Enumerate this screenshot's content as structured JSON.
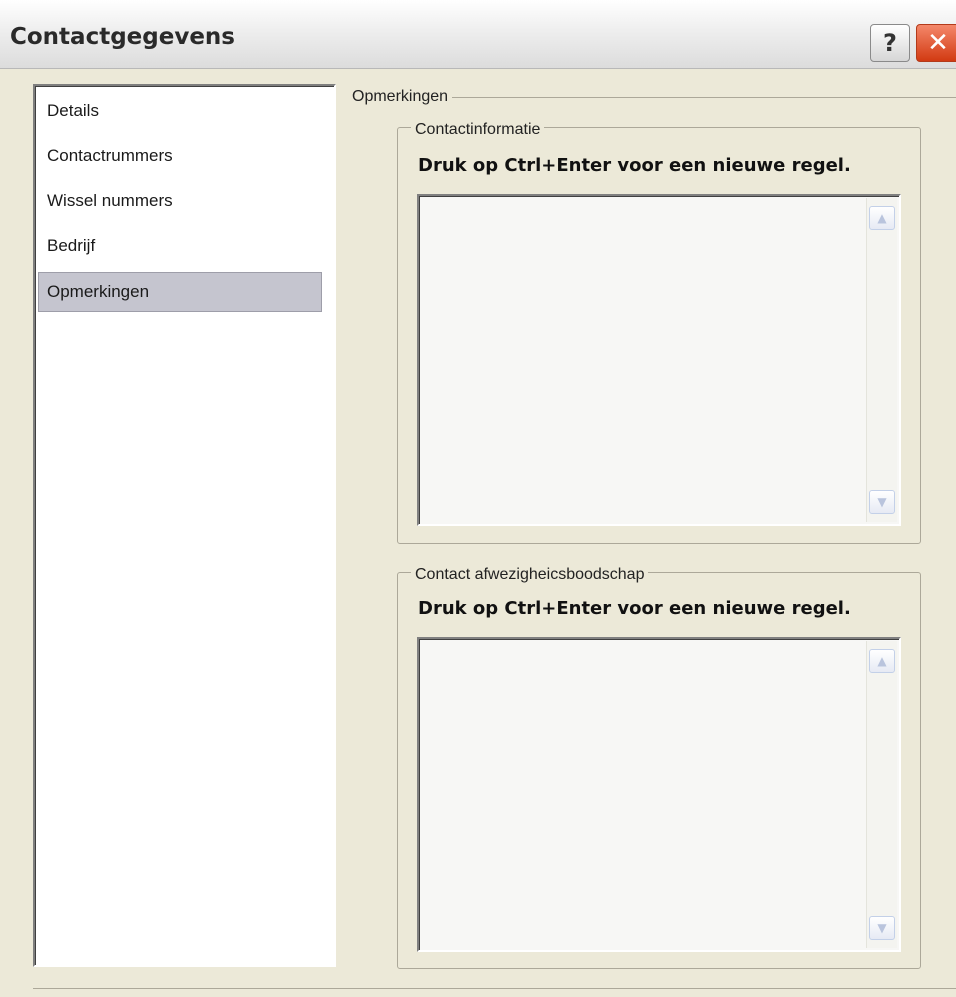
{
  "window": {
    "title": "Contactgegevens",
    "help_label": "?",
    "close_label": "✕"
  },
  "sidebar": {
    "items": [
      {
        "label": "Details"
      },
      {
        "label": "Contactrummers"
      },
      {
        "label": "Wissel nummers"
      },
      {
        "label": "Bedrijf"
      },
      {
        "label": "Opmerkingen",
        "selected": true
      }
    ]
  },
  "main": {
    "section_title": "Opmerkingen",
    "contact_info": {
      "legend": "Contactinformatie",
      "hint": "Druk op Ctrl+Enter voor een nieuwe regel.",
      "value": ""
    },
    "absence_message": {
      "legend": "Contact afwezigheicsboodschap",
      "hint": "Druk op Ctrl+Enter voor een nieuwe regel.",
      "value": ""
    }
  },
  "icons": {
    "scroll_up": "chevron-up-icon",
    "scroll_down": "chevron-down-icon"
  },
  "colors": {
    "selection": "#c5c5cf",
    "dialog_background": "#ece9d8",
    "close_button": "#d23a12"
  }
}
